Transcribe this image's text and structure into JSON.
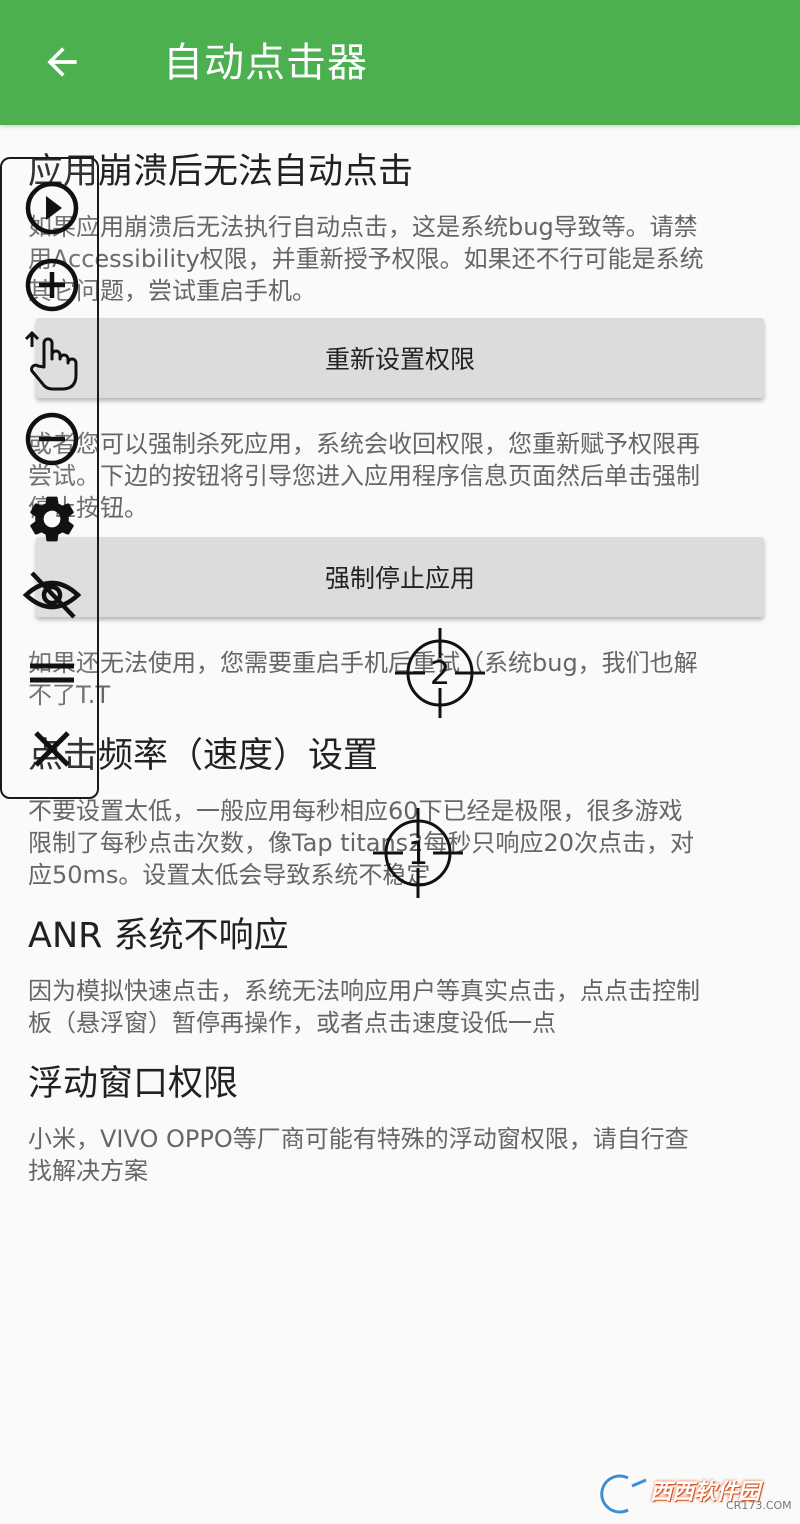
{
  "app_bar": {
    "title": "自动点击器",
    "back_icon": "arrow-back-icon",
    "color": "#4caf50"
  },
  "sections": {
    "crash": {
      "title": "应用崩溃后无法自动点击",
      "lines": [
        "如果应用崩溃后无法执行自动点击，这是系统bug导致等。请禁",
        "用Accessibility权限，并重新授予权限。如果还不行可能是系统",
        "其它问题，尝试重启手机。"
      ],
      "button": "重新设置权限"
    },
    "kill": {
      "lines": [
        "或者您可以强制杀死应用，系统会收回权限，您重新赋予权限再",
        "尝试。下边的按钮将引导您进入应用程序信息页面然后单击强制",
        "停止按钮。"
      ],
      "button": "强制停止应用"
    },
    "restart": {
      "lines": [
        "如果还无法使用，您需要重启手机后重试（系统bug，我们也解",
        "不了T.T"
      ]
    },
    "speed": {
      "title": "点击频率（速度）设置",
      "lines": [
        "不要设置太低，一般应用每秒相应60下已经是极限，很多游戏",
        "限制了每秒点击次数，像Tap titans2每秒只响应20次点击，对",
        "应50ms。设置太低会导致系统不稳定"
      ]
    },
    "anr": {
      "title": "ANR 系统不响应",
      "lines": [
        "因为模拟快速点击，系统无法响应用户等真实点击，点点击控制",
        "板（悬浮窗）暂停再操作，或者点击速度设低一点"
      ]
    },
    "overlay": {
      "title": "浮动窗口权限",
      "lines": [
        "小米，VIVO OPPO等厂商可能有特殊的浮动窗权限，请自行查",
        "找解决方案"
      ]
    }
  },
  "floating_panel": {
    "icons": [
      "play-icon",
      "add-circle-icon",
      "swipe-gesture-icon",
      "remove-circle-icon",
      "settings-gear-icon",
      "eye-off-icon",
      "menu-drag-icon",
      "close-icon"
    ]
  },
  "targets": [
    {
      "label": "2"
    },
    {
      "label": "1"
    }
  ],
  "watermark": {
    "text": "西西软件园",
    "sub": "CR173.COM"
  }
}
